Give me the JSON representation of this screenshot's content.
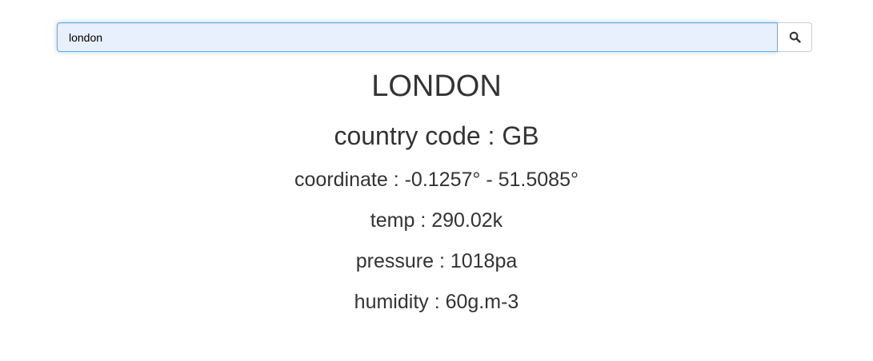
{
  "search": {
    "value": "london",
    "button_icon": "search-icon"
  },
  "result": {
    "city": "LONDON",
    "country_line": "country code : GB",
    "coordinate_line": "coordinate : -0.1257° - 51.5085°",
    "temp_line": "temp : 290.02k",
    "pressure_line": "pressure : 1018pa",
    "humidity_line": "humidity : 60g.m-3"
  },
  "colors": {
    "text": "#333333",
    "input_background": "#e8f0fe",
    "input_focus_border": "#66afe9",
    "button_border": "#cccccc"
  }
}
